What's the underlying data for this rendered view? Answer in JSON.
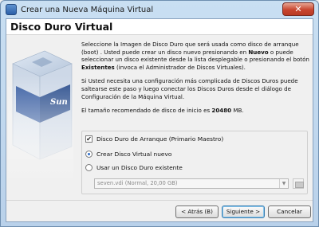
{
  "window": {
    "title": "Crear una Nueva Máquina Virtual",
    "close_glyph": "✕"
  },
  "header": {
    "title": "Disco Duro Virtual"
  },
  "side_image": {
    "brand_text": "Sun"
  },
  "body": {
    "p1_a": "Seleccione la Imagen de Disco Duro que será usada como disco de arranque (boot) . Usted puede crear un disco nuevo presionando en ",
    "p1_b": "Nuevo",
    "p1_c": " o puede seleccionar un disco existente desde la lista desplegable o presionando el botón ",
    "p1_d": "Existentes",
    "p1_e": " (invoca el Administrador de Discos Virtuales).",
    "p2": "Si Usted necesita una configuración más complicada de Discos Duros puede saltearse este paso y luego conectar los Discos Duros desde el diálogo de Configuración de la Máquina Virtual.",
    "p3_a": "El tamaño recomendado de disco de inicio es ",
    "p3_b": "20480",
    "p3_c": " MB."
  },
  "options": {
    "boot_checkbox_label": "Disco Duro de Arranque (Primario Maestro)",
    "boot_checked": true,
    "check_glyph": "✔",
    "new_radio_label": "Crear Disco Virtual nuevo",
    "new_selected": true,
    "existing_radio_label": "Usar un Disco Duro existente",
    "existing_selected": false,
    "disk_combo_value": "seven.vdi (Normal, 20,00 GB)",
    "combo_arrow": "▼"
  },
  "footer": {
    "back_label": "< Atrás (B)",
    "next_label": "Siguiente >",
    "cancel_label": "Cancelar"
  },
  "colors": {
    "titlebar_bg": "#c9dff2",
    "close_button": "#c8452f",
    "default_button_border": "#3c7fb1"
  }
}
